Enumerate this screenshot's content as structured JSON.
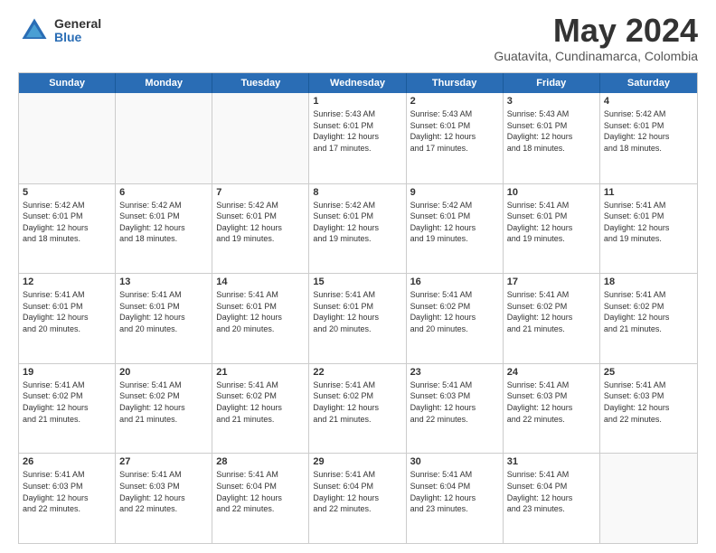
{
  "logo": {
    "general": "General",
    "blue": "Blue"
  },
  "title": "May 2024",
  "location": "Guatavita, Cundinamarca, Colombia",
  "days": [
    "Sunday",
    "Monday",
    "Tuesday",
    "Wednesday",
    "Thursday",
    "Friday",
    "Saturday"
  ],
  "weeks": [
    [
      {
        "num": "",
        "text": "",
        "empty": true
      },
      {
        "num": "",
        "text": "",
        "empty": true
      },
      {
        "num": "",
        "text": "",
        "empty": true
      },
      {
        "num": "1",
        "text": "Sunrise: 5:43 AM\nSunset: 6:01 PM\nDaylight: 12 hours\nand 17 minutes."
      },
      {
        "num": "2",
        "text": "Sunrise: 5:43 AM\nSunset: 6:01 PM\nDaylight: 12 hours\nand 17 minutes."
      },
      {
        "num": "3",
        "text": "Sunrise: 5:43 AM\nSunset: 6:01 PM\nDaylight: 12 hours\nand 18 minutes."
      },
      {
        "num": "4",
        "text": "Sunrise: 5:42 AM\nSunset: 6:01 PM\nDaylight: 12 hours\nand 18 minutes."
      }
    ],
    [
      {
        "num": "5",
        "text": "Sunrise: 5:42 AM\nSunset: 6:01 PM\nDaylight: 12 hours\nand 18 minutes."
      },
      {
        "num": "6",
        "text": "Sunrise: 5:42 AM\nSunset: 6:01 PM\nDaylight: 12 hours\nand 18 minutes."
      },
      {
        "num": "7",
        "text": "Sunrise: 5:42 AM\nSunset: 6:01 PM\nDaylight: 12 hours\nand 19 minutes."
      },
      {
        "num": "8",
        "text": "Sunrise: 5:42 AM\nSunset: 6:01 PM\nDaylight: 12 hours\nand 19 minutes."
      },
      {
        "num": "9",
        "text": "Sunrise: 5:42 AM\nSunset: 6:01 PM\nDaylight: 12 hours\nand 19 minutes."
      },
      {
        "num": "10",
        "text": "Sunrise: 5:41 AM\nSunset: 6:01 PM\nDaylight: 12 hours\nand 19 minutes."
      },
      {
        "num": "11",
        "text": "Sunrise: 5:41 AM\nSunset: 6:01 PM\nDaylight: 12 hours\nand 19 minutes."
      }
    ],
    [
      {
        "num": "12",
        "text": "Sunrise: 5:41 AM\nSunset: 6:01 PM\nDaylight: 12 hours\nand 20 minutes."
      },
      {
        "num": "13",
        "text": "Sunrise: 5:41 AM\nSunset: 6:01 PM\nDaylight: 12 hours\nand 20 minutes."
      },
      {
        "num": "14",
        "text": "Sunrise: 5:41 AM\nSunset: 6:01 PM\nDaylight: 12 hours\nand 20 minutes."
      },
      {
        "num": "15",
        "text": "Sunrise: 5:41 AM\nSunset: 6:01 PM\nDaylight: 12 hours\nand 20 minutes."
      },
      {
        "num": "16",
        "text": "Sunrise: 5:41 AM\nSunset: 6:02 PM\nDaylight: 12 hours\nand 20 minutes."
      },
      {
        "num": "17",
        "text": "Sunrise: 5:41 AM\nSunset: 6:02 PM\nDaylight: 12 hours\nand 21 minutes."
      },
      {
        "num": "18",
        "text": "Sunrise: 5:41 AM\nSunset: 6:02 PM\nDaylight: 12 hours\nand 21 minutes."
      }
    ],
    [
      {
        "num": "19",
        "text": "Sunrise: 5:41 AM\nSunset: 6:02 PM\nDaylight: 12 hours\nand 21 minutes."
      },
      {
        "num": "20",
        "text": "Sunrise: 5:41 AM\nSunset: 6:02 PM\nDaylight: 12 hours\nand 21 minutes."
      },
      {
        "num": "21",
        "text": "Sunrise: 5:41 AM\nSunset: 6:02 PM\nDaylight: 12 hours\nand 21 minutes."
      },
      {
        "num": "22",
        "text": "Sunrise: 5:41 AM\nSunset: 6:02 PM\nDaylight: 12 hours\nand 21 minutes."
      },
      {
        "num": "23",
        "text": "Sunrise: 5:41 AM\nSunset: 6:03 PM\nDaylight: 12 hours\nand 22 minutes."
      },
      {
        "num": "24",
        "text": "Sunrise: 5:41 AM\nSunset: 6:03 PM\nDaylight: 12 hours\nand 22 minutes."
      },
      {
        "num": "25",
        "text": "Sunrise: 5:41 AM\nSunset: 6:03 PM\nDaylight: 12 hours\nand 22 minutes."
      }
    ],
    [
      {
        "num": "26",
        "text": "Sunrise: 5:41 AM\nSunset: 6:03 PM\nDaylight: 12 hours\nand 22 minutes."
      },
      {
        "num": "27",
        "text": "Sunrise: 5:41 AM\nSunset: 6:03 PM\nDaylight: 12 hours\nand 22 minutes."
      },
      {
        "num": "28",
        "text": "Sunrise: 5:41 AM\nSunset: 6:04 PM\nDaylight: 12 hours\nand 22 minutes."
      },
      {
        "num": "29",
        "text": "Sunrise: 5:41 AM\nSunset: 6:04 PM\nDaylight: 12 hours\nand 22 minutes."
      },
      {
        "num": "30",
        "text": "Sunrise: 5:41 AM\nSunset: 6:04 PM\nDaylight: 12 hours\nand 23 minutes."
      },
      {
        "num": "31",
        "text": "Sunrise: 5:41 AM\nSunset: 6:04 PM\nDaylight: 12 hours\nand 23 minutes."
      },
      {
        "num": "",
        "text": "",
        "empty": true
      }
    ]
  ]
}
